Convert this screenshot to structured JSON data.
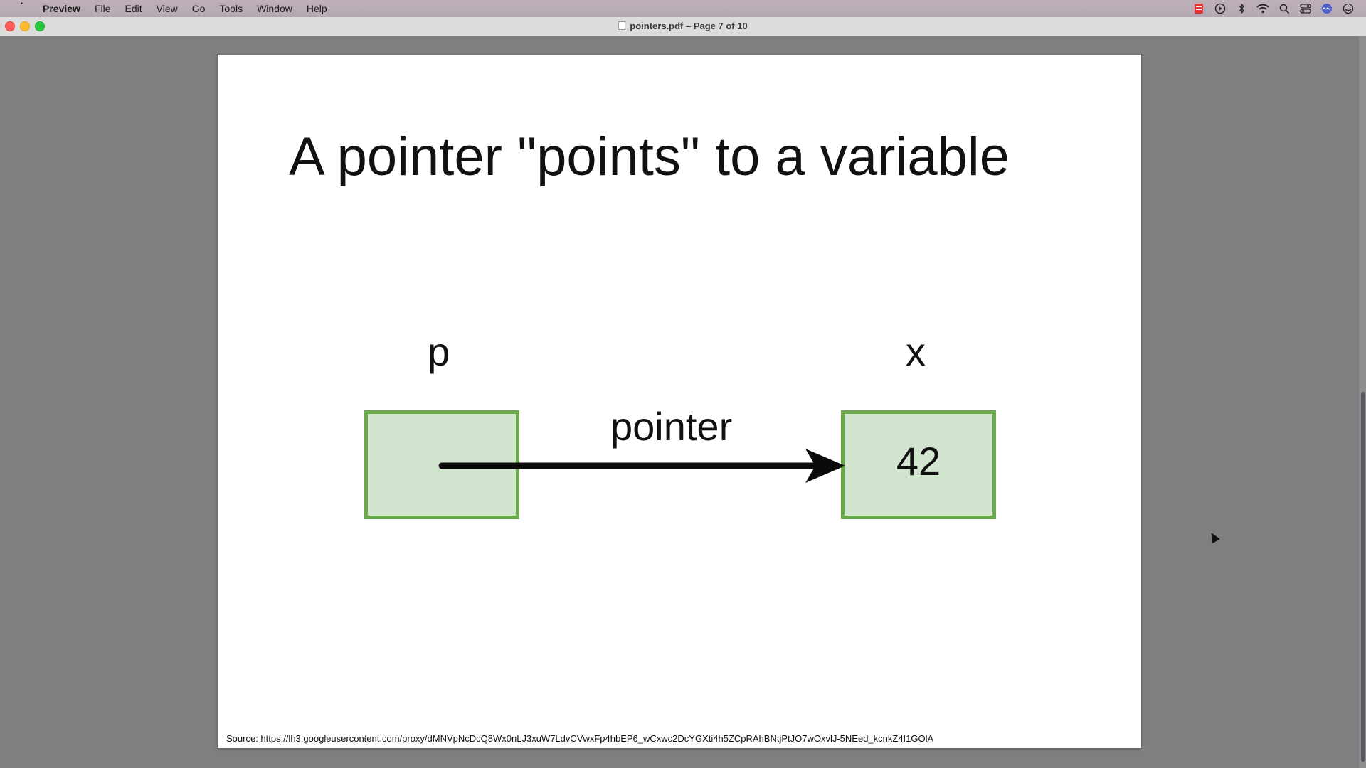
{
  "menubar": {
    "app_name": "Preview",
    "items": [
      "File",
      "Edit",
      "View",
      "Go",
      "Tools",
      "Window",
      "Help"
    ],
    "status_icons": [
      "screen-record-icon",
      "play-icon",
      "bluetooth-icon",
      "wifi-icon",
      "search-icon",
      "control-center-icon",
      "siri-icon",
      "user-icon"
    ]
  },
  "window": {
    "title": "pointers.pdf – Page 7 of 10"
  },
  "slide": {
    "title": "A pointer \"points\" to a variable",
    "left_var": "p",
    "right_var": "x",
    "arrow_label": "pointer",
    "value": "42",
    "source": "Source: https://lh3.googleusercontent.com/proxy/dMNVpNcDcQ8Wx0nLJ3xuW7LdvCVwxFp4hbEP6_wCxwc2DcYGXti4h5ZCpRAhBNtjPtJO7wOxvlJ-5NEed_kcnkZ4I1GOlA"
  },
  "colors": {
    "box_fill": "#d1e5cf",
    "box_border": "#6aaa4b"
  }
}
